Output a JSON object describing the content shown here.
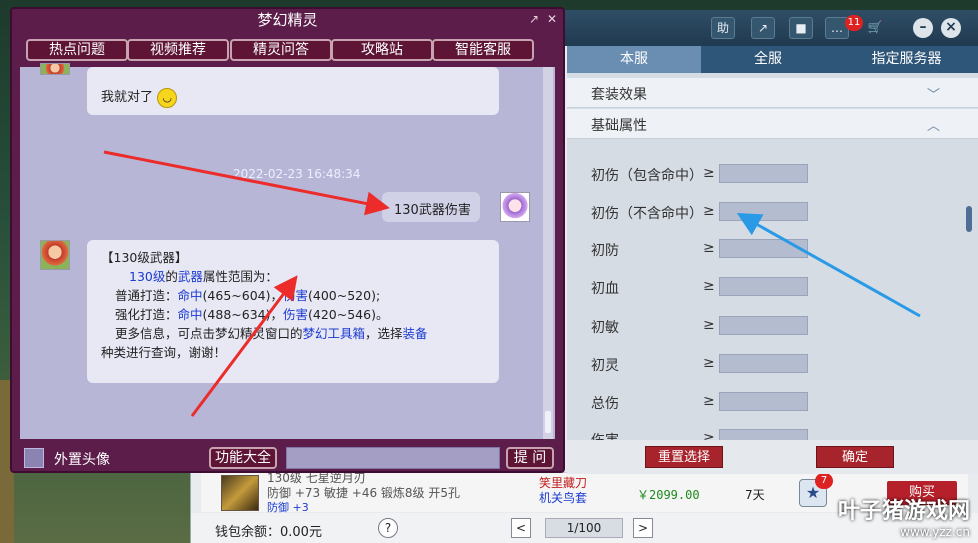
{
  "chat": {
    "title": "梦幻精灵",
    "nav": [
      "热点问题",
      "视频推荐",
      "精灵问答",
      "攻略站",
      "智能客服"
    ],
    "msg1": "我就对了",
    "timestamp": "2022-02-23 16:48:34",
    "user_msg": "130武器伤害",
    "reply": {
      "line1": "【130级武器】",
      "l2a": "130级",
      "l2b": "的",
      "l2c": "武器",
      "l2d": "属性范围为：",
      "l3a": "普通打造：",
      "l3b": "命中",
      "l3c": "(465~604)，",
      "l3d": "伤害",
      "l3e": "(400~520);",
      "l4a": "强化打造：",
      "l4b": "命中",
      "l4c": "(488~634)，",
      "l4d": "伤害",
      "l4e": "(420~546)。",
      "l5a": "更多信息，可点击梦幻精灵窗口的",
      "l5b": "梦幻工具箱",
      "l5c": "，选择",
      "l5d": "装备",
      "l6": "种类进行查询，谢谢！"
    },
    "footer": {
      "avatar_label": "外置头像",
      "func_btn": "功能大全",
      "ask_btn": "提 问"
    }
  },
  "toolbar": {
    "help_label": "助",
    "badge": "11"
  },
  "filter": {
    "tabs": [
      "本服",
      "全服",
      "指定服务器"
    ],
    "sections": [
      "套装效果",
      "基础属性"
    ],
    "rows": [
      "初伤（包含命中）",
      "初伤（不含命中）",
      "初防",
      "初血",
      "初敏",
      "初灵",
      "总伤",
      "伤害"
    ],
    "ge": "≥",
    "reset": "重置选择",
    "confirm": "确定"
  },
  "listing": {
    "name": "130级 七星逆月刃",
    "stats": "防御 +73  敏捷 +46  锻炼8级  开5孔",
    "stats2": "防御 +3",
    "seller1": "笑里藏刀",
    "seller2": "机关鸟套",
    "price": "￥2099.00",
    "days": "7天",
    "star_badge": "7",
    "buy": "购买"
  },
  "footer": {
    "wallet": "钱包余额：0.00元",
    "help": "?",
    "page": "1/100"
  },
  "watermark": {
    "main": "叶子猪游戏网",
    "url": "www.yzz.cn"
  }
}
